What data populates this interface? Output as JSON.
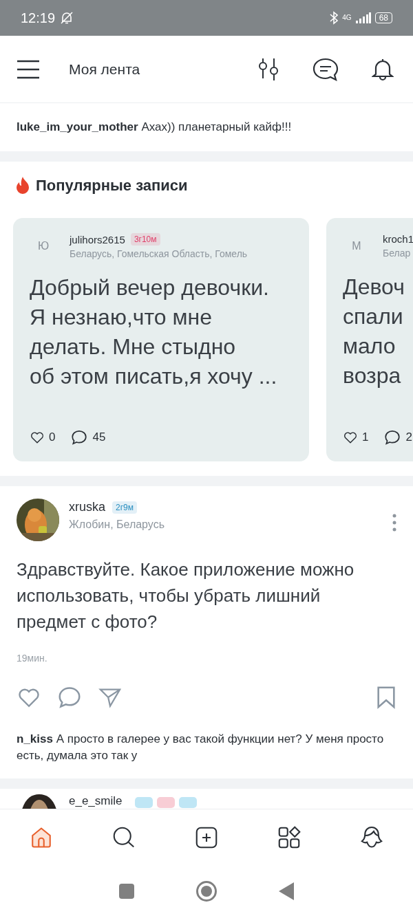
{
  "status_bar": {
    "time": "12:19",
    "network": "4G",
    "battery": "68"
  },
  "header": {
    "title": "Моя лента"
  },
  "latest_comment": {
    "user": "luke_im_your_mother",
    "text": "Ахах)) планетарный кайф!!!"
  },
  "popular": {
    "title": "Популярные записи",
    "cards": [
      {
        "avatar_letter": "Ю",
        "user": "julihors2615",
        "badge": {
          "text": "3г10м",
          "color": "#e0406a"
        },
        "location": "Беларусь, Гомельская Область, Гомель",
        "lines": [
          "Добрый вечер девочки.",
          "Я незнаю,что мне",
          "делать. Мне стыдно",
          "об этом писать,я хочу ..."
        ],
        "likes": "0",
        "comments": "45"
      },
      {
        "avatar_letter": "М",
        "user": "kroch1",
        "location": "Белар",
        "lines": [
          "Девоч",
          "спали",
          "мало",
          "возра"
        ],
        "likes": "1",
        "comments": "2"
      }
    ]
  },
  "post": {
    "user": "xruska",
    "badge": {
      "text": "2г9м",
      "color": "#2a8fc0"
    },
    "location": "Жлобин, Беларусь",
    "text": "Здравствуйте. Какое приложение можно использовать, чтобы убрать лишний предмет с фото?",
    "time": "19мин.",
    "comment": {
      "user": "n_kiss",
      "text": "А просто в галерее у вас такой функции нет? У меня просто есть, думала это так у"
    }
  },
  "next_post": {
    "user": "e_e_smile",
    "badges": [
      {
        "color": "#bfe6f5"
      },
      {
        "color": "#f8cdd5"
      },
      {
        "color": "#bfe6f5"
      }
    ]
  },
  "bottom_nav": [
    {
      "kind": "home",
      "selected": true
    },
    {
      "kind": "search",
      "selected": false
    },
    {
      "kind": "add",
      "selected": false
    },
    {
      "kind": "apps",
      "selected": false
    },
    {
      "kind": "profile",
      "selected": false
    }
  ]
}
